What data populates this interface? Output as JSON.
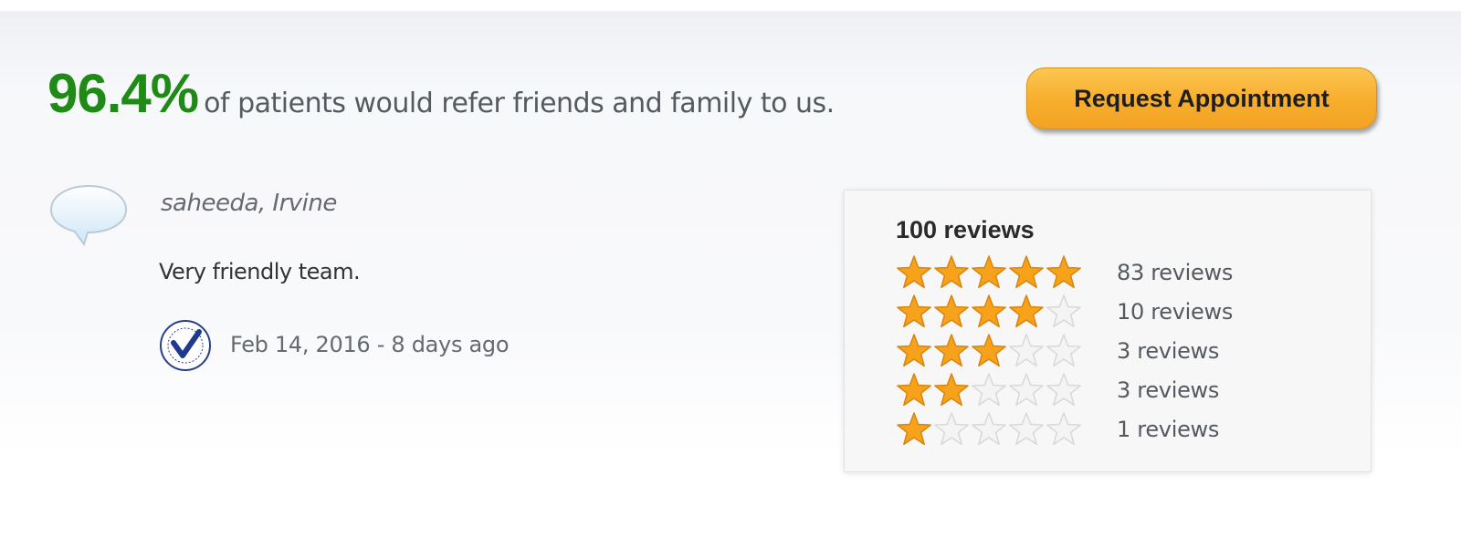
{
  "headline": {
    "percent": "96.4%",
    "text": "of patients would refer friends and family to us."
  },
  "appointment_button": {
    "label": "Request Appointment",
    "color": "#f7ad2c"
  },
  "review": {
    "icon": "speech-bubble-icon",
    "author": "saheeda, Irvine",
    "text": "Very friendly team.",
    "badge_icon": "verified-review-badge-icon",
    "date": "Feb 14, 2016 - 8 days ago"
  },
  "summary": {
    "title": "100 reviews",
    "rows": [
      {
        "stars": 5,
        "label": "83 reviews"
      },
      {
        "stars": 4,
        "label": "10 reviews"
      },
      {
        "stars": 3,
        "label": "3 reviews"
      },
      {
        "stars": 2,
        "label": "3 reviews"
      },
      {
        "stars": 1,
        "label": "1 reviews"
      }
    ]
  },
  "colors": {
    "accent_green": "#1f8a16",
    "star_filled": "#f7a21b",
    "star_empty": "#d8d8d8"
  }
}
